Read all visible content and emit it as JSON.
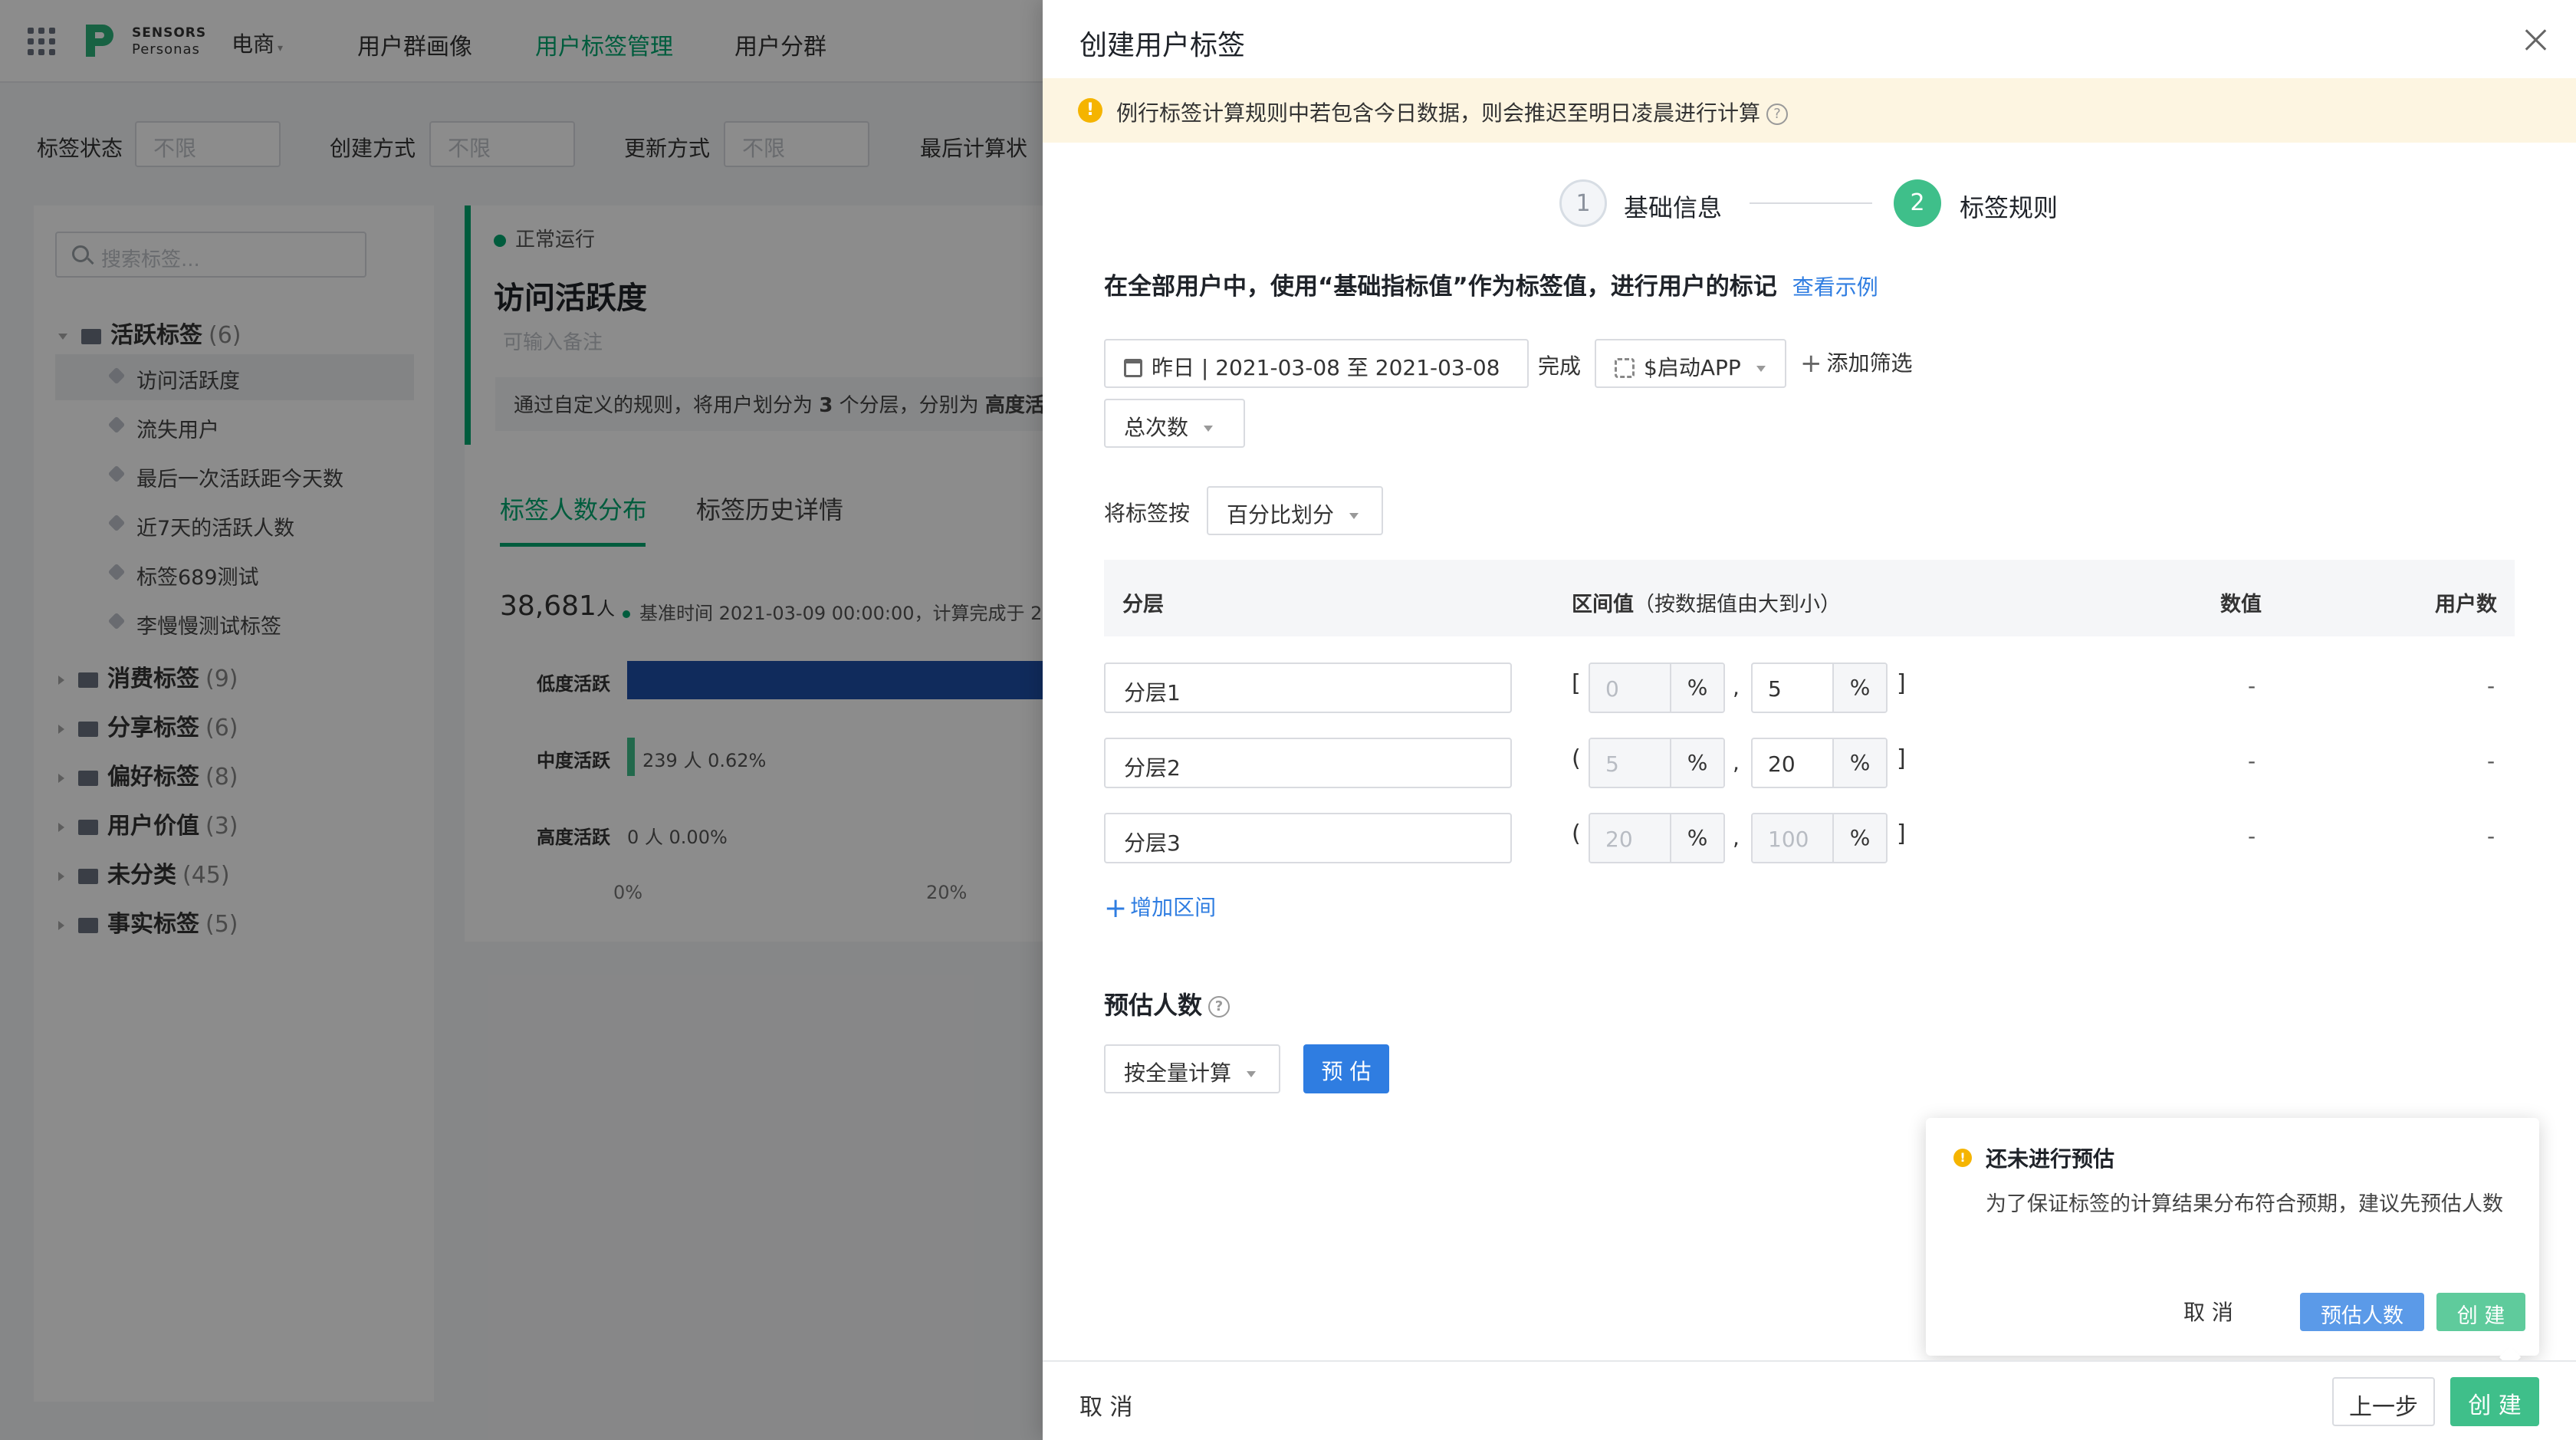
{
  "background": {
    "topbar": {
      "logo_line1": "SENSORS",
      "logo_line2": "Personas",
      "product": "电商",
      "nav": [
        "用户群画像",
        "用户标签管理",
        "用户分群"
      ]
    },
    "filters": [
      {
        "label": "标签状态",
        "value": "不限"
      },
      {
        "label": "创建方式",
        "value": "不限"
      },
      {
        "label": "更新方式",
        "value": "不限"
      },
      {
        "label": "最后计算状",
        "value": ""
      }
    ],
    "sidebar": {
      "search_placeholder": "搜索标签...",
      "groups": [
        {
          "name": "活跃标签",
          "count": "(6)",
          "items": [
            "访问活跃度",
            "流失用户",
            "最后一次活跃距今天数",
            "近7天的活跃人数",
            "标签689测试",
            "李慢慢测试标签"
          ]
        },
        {
          "name": "消费标签",
          "count": "(9)"
        },
        {
          "name": "分享标签",
          "count": "(6)"
        },
        {
          "name": "偏好标签",
          "count": "(8)"
        },
        {
          "name": "用户价值",
          "count": "(3)"
        },
        {
          "name": "未分类",
          "count": "(45)"
        },
        {
          "name": "事实标签",
          "count": "(5)"
        }
      ]
    },
    "detail": {
      "status": "正常运行",
      "title": "访问活跃度",
      "note_placeholder": "可输入备注",
      "desc_prefix": "通过自定义的规则，将用户划分为",
      "desc_count": "3",
      "desc_mid": "个分层，分别为",
      "desc_bold": "高度活",
      "tabs": [
        "标签人数分布",
        "标签历史详情"
      ],
      "total_count": "38,681",
      "total_unit": "人",
      "base_time": "基准时间 2021-03-09 00:00:00，计算完成于 2",
      "bars": [
        {
          "label": "低度活跃",
          "value_text": ""
        },
        {
          "label": "中度活跃",
          "value_text": "239 人 0.62%"
        },
        {
          "label": "高度活跃",
          "value_text": "0 人 0.00%"
        }
      ],
      "axis_ticks": [
        "0%",
        "20%"
      ]
    }
  },
  "drawer": {
    "title": "创建用户标签",
    "warning": "例行标签计算规则中若包含今日数据，则会推迟至明日凌晨进行计算",
    "steps": [
      {
        "num": "1",
        "label": "基础信息"
      },
      {
        "num": "2",
        "label": "标签规则"
      }
    ],
    "rule_desc": "在全部用户中，使用“基础指标值”作为标签值，进行用户的标记",
    "example_link": "查看示例",
    "date_range": "昨日 | 2021-03-08 至 2021-03-08",
    "done_text": "完成",
    "event": "$启动APP",
    "add_filter": "添加筛选",
    "metric": "总次数",
    "divide_label": "将标签按",
    "divide_mode": "百分比划分",
    "table": {
      "headers": {
        "layer": "分层",
        "range": "区间值",
        "range_sub": "（按数据值由大到小）",
        "value": "数值",
        "users": "用户数"
      },
      "rows": [
        {
          "name": "分层1",
          "open": "[",
          "from": "0",
          "to": "5",
          "close": "]",
          "value": "-",
          "users": "-"
        },
        {
          "name": "分层2",
          "open": "(",
          "from": "5",
          "to": "20",
          "close": "]",
          "value": "-",
          "users": "-"
        },
        {
          "name": "分层3",
          "open": "(",
          "from": "20",
          "to": "100",
          "close": "]",
          "value": "-",
          "users": "-"
        }
      ],
      "pct": "%",
      "comma": ","
    },
    "add_range": "增加区间",
    "estimate_title": "预估人数",
    "calc_mode": "按全量计算",
    "estimate_btn": "预 估",
    "footer": {
      "cancel": "取 消",
      "prev": "上一步",
      "create": "创 建"
    },
    "popconfirm": {
      "title": "还未进行预估",
      "body": "为了保证标签的计算结果分布符合预期，建议先预估人数",
      "cancel": "取 消",
      "estimate": "预估人数",
      "create": "创 建"
    }
  },
  "colors": {
    "accent_green": "#3fbf8a",
    "link_blue": "#2f7de1",
    "warn_yellow": "#f5b400",
    "bar_blue": "#1e4fa8"
  }
}
